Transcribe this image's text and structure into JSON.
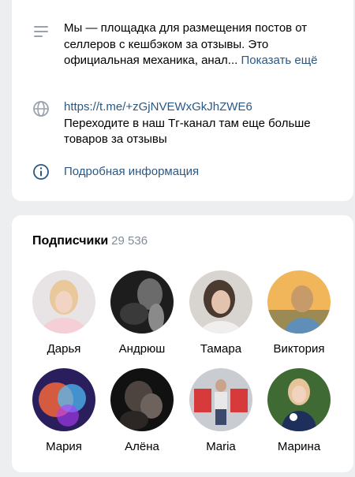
{
  "about": {
    "description_text": "Мы — площадка для размещения постов от селлеров с кешбэком за отзывы. Это официальная механика, анал...",
    "show_more_label": "Показать ещё",
    "link_url": "https://t.me/+zGjNVEWxGkJhZWE6",
    "link_caption": "Переходите в наш Тг-канал там еще больше товаров за отзывы",
    "details_label": "Подробная информация",
    "accent_color": "#2a5885"
  },
  "subscribers": {
    "title": "Подписчики",
    "count": "29 536",
    "items": [
      {
        "name": "Дарья",
        "avatar_icon": "user-avatar"
      },
      {
        "name": "Андрюш",
        "avatar_icon": "user-avatar"
      },
      {
        "name": "Тамара",
        "avatar_icon": "user-avatar"
      },
      {
        "name": "Виктория",
        "avatar_icon": "user-avatar"
      },
      {
        "name": "Мария",
        "avatar_icon": "user-avatar"
      },
      {
        "name": "Алёна",
        "avatar_icon": "user-avatar"
      },
      {
        "name": "Maria",
        "avatar_icon": "user-avatar"
      },
      {
        "name": "Марина",
        "avatar_icon": "user-avatar"
      }
    ]
  }
}
